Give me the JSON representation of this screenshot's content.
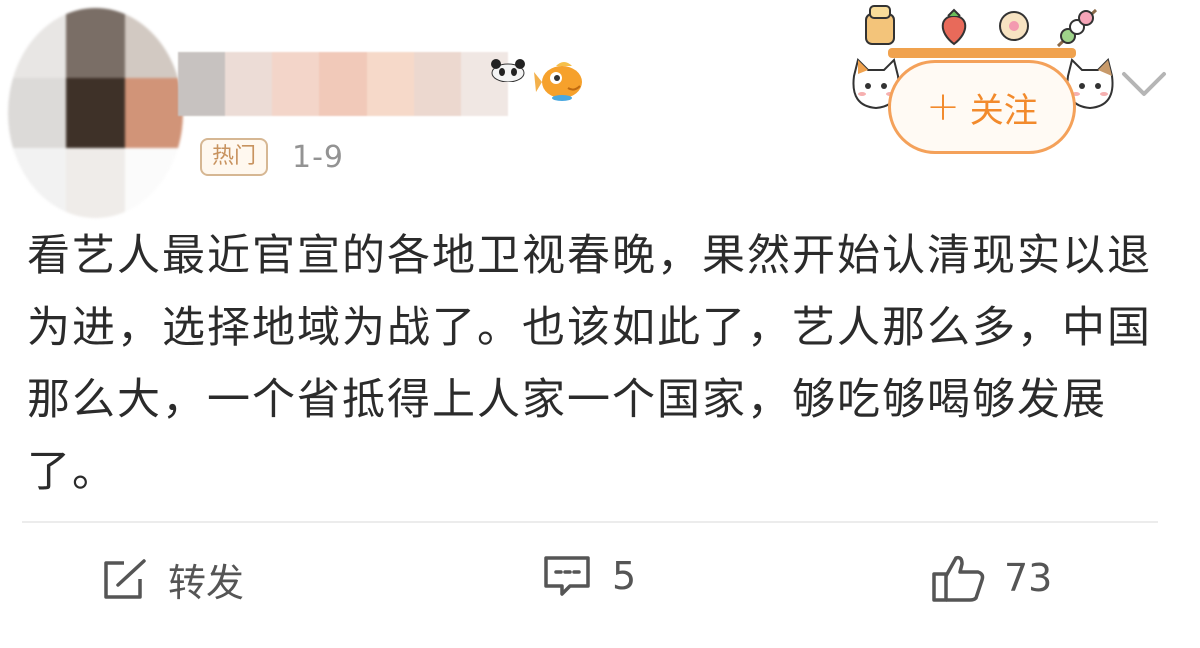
{
  "post": {
    "badge": "热门",
    "date": "1-9",
    "follow_label": "关注",
    "follow_plus": "+",
    "text": "看艺人最近官宣的各地卫视春晚，果然开始认清现实以退为进，选择地域为战了。也该如此了，艺人那么多，中国那么大，一个省抵得上人家一个国家，够吃够喝够发展了。"
  },
  "actions": {
    "repost_label": "转发",
    "comment_count": "5",
    "like_count": "73"
  },
  "colors": {
    "accent_orange": "#f28a2c",
    "badge_text": "#c8935f",
    "text_main": "#2b2b2b",
    "meta_gray": "#939393"
  },
  "icons": {
    "repost": "share-icon",
    "comment": "comment-icon",
    "like": "thumbs-up-icon",
    "more": "chevron-down-icon"
  }
}
